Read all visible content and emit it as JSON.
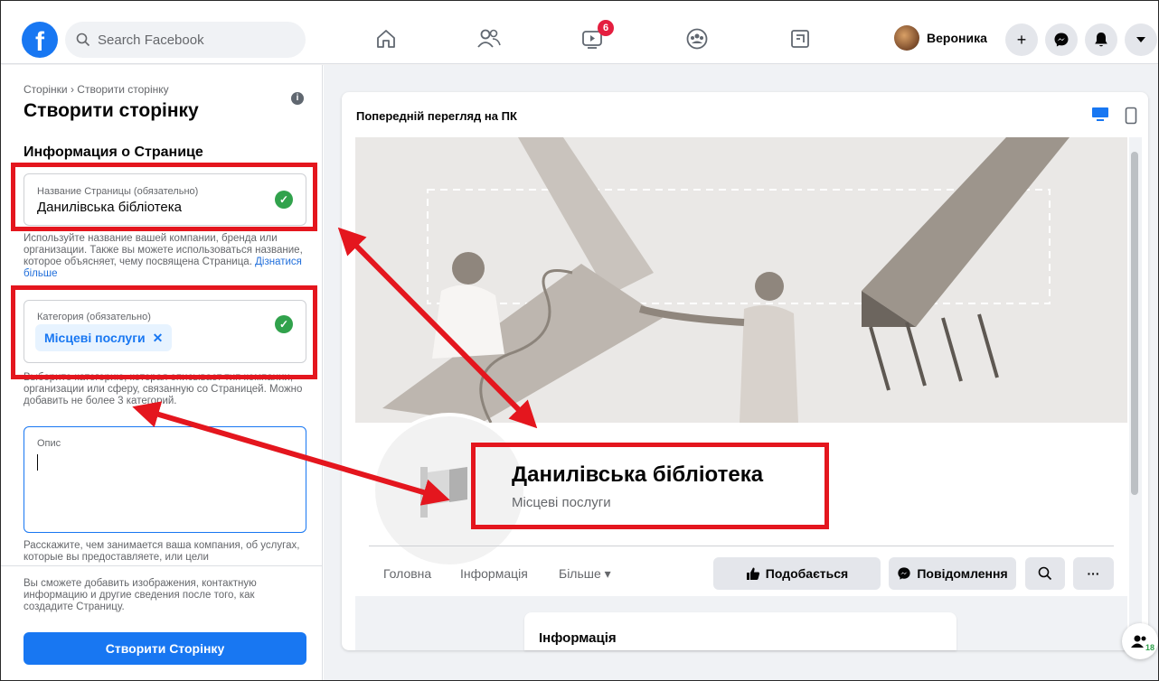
{
  "topbar": {
    "logo": "f",
    "search_placeholder": "Search Facebook",
    "watch_badge": "6",
    "user_name": "Вероника",
    "plus": "+"
  },
  "sidebar": {
    "breadcrumb": "Сторінки › Створити сторінку",
    "title": "Створити сторінку",
    "section": "Информация о Странице",
    "name_field": {
      "label": "Название Страницы (обязательно)",
      "value": "Данилівська бібліотека"
    },
    "name_help": "Используйте название вашей компании, бренда или организации. Также вы можете использоваться название, которое объясняет, чему посвящена Страница.",
    "learn_more": "Дізнатися більше",
    "category_field": {
      "label": "Категория (обязательно)",
      "chip": "Місцеві послуги",
      "chip_x": "✕"
    },
    "category_help": "Выберите категорию, которая описывает тип компании, организации или сферу, связанную со Страницей. Можно добавить не более 3 категорий.",
    "desc_field": {
      "label": "Опис"
    },
    "desc_help": "Расскажите, чем занимается ваша компания, об услугах, которые вы предоставляете, или цели",
    "footer_note": "Вы сможете добавить изображения, контактную информацию и другие сведения после того, как создадите Страницу.",
    "create_button": "Створити Сторінку"
  },
  "preview": {
    "title": "Попередній перегляд на ПК",
    "page_name": "Данилівська бібліотека",
    "page_category": "Місцеві послуги",
    "tabs": [
      "Головна",
      "Інформація",
      "Більше ▾"
    ],
    "like_button": "Подобається",
    "message_button": "Повідомлення",
    "more_button": "···",
    "info_card_title": "Інформація"
  },
  "people_count": "18",
  "colors": {
    "accent": "#1877f2",
    "check": "#31a24c",
    "highlight": "#e4161e",
    "badge": "#e41e3f"
  }
}
